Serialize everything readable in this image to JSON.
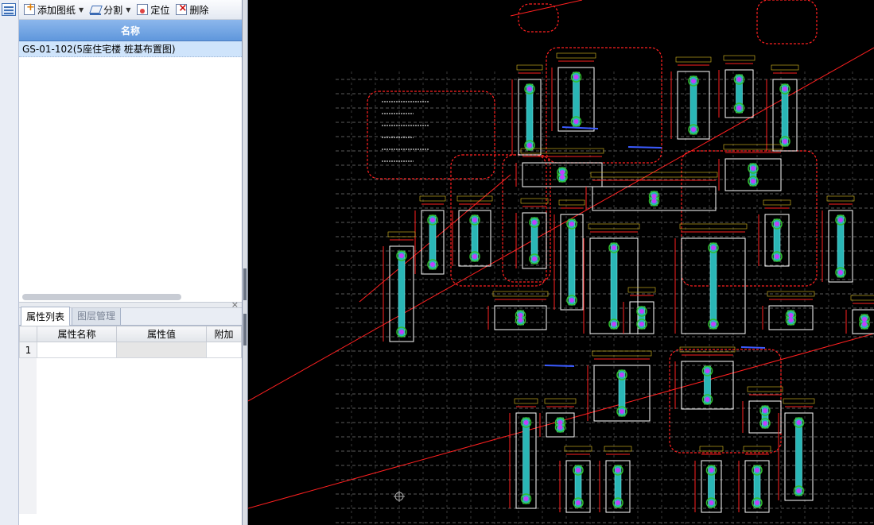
{
  "nav": {
    "icon": "panel-menu-icon"
  },
  "toolbar": {
    "add_drawing": "添加图纸",
    "split": "分割",
    "locate": "定位",
    "delete": "删除"
  },
  "drawing_list": {
    "header": "名称",
    "rows": [
      {
        "name": "GS-01-102(5座住宅楼 桩基布置图)"
      }
    ]
  },
  "tabs": {
    "properties": "属性列表",
    "layers": "图层管理"
  },
  "properties": {
    "columns": {
      "name": "属性名称",
      "value": "属性值",
      "extra": "附加"
    },
    "rows": [
      {
        "index": "1",
        "name": "",
        "value": "",
        "extra": ""
      }
    ]
  },
  "canvas": {
    "background": "#000000",
    "accent_colors": {
      "dim": "#ff2020",
      "structure": "#2ab6b6",
      "pile": "#2fbf2f",
      "note": "#ffffff",
      "tag": "#3b5bff"
    }
  }
}
